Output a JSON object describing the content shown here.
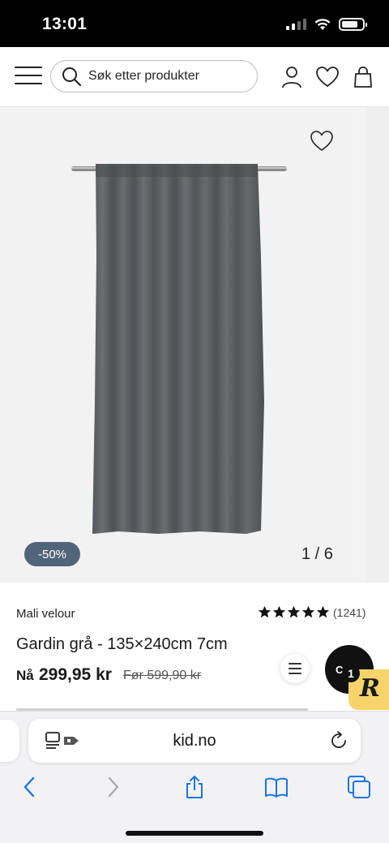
{
  "status_bar": {
    "time": "13:01"
  },
  "header": {
    "search": {
      "placeholder": "Søk etter produkter"
    },
    "icons": [
      "menu-icon",
      "search-icon",
      "user-icon",
      "heart-icon",
      "bag-icon"
    ]
  },
  "gallery": {
    "discount_badge": "-50%",
    "pager": "1 / 6",
    "image_alt_icon": "curtain-image"
  },
  "product": {
    "brand": "Mali velour",
    "rating_count": "(1241)",
    "stars": 5,
    "title": "Gardin grå - 135×240cm 7cm",
    "price_now_label": "Nå",
    "price_now": "299,95 kr",
    "price_before": "Før 599,90 kr"
  },
  "floating": {
    "cart_label": "C",
    "badge_count": "1",
    "badge_letter": "R"
  },
  "browser": {
    "url": "kid.no",
    "icons": [
      "tab-format-icon",
      "reload-icon",
      "back-icon",
      "forward-icon",
      "share-icon",
      "bookmarks-icon",
      "tabs-icon"
    ]
  },
  "colors": {
    "badge_bg": "#52647a",
    "curtain": "#5d6062",
    "r_badge": "#f7d36b"
  }
}
